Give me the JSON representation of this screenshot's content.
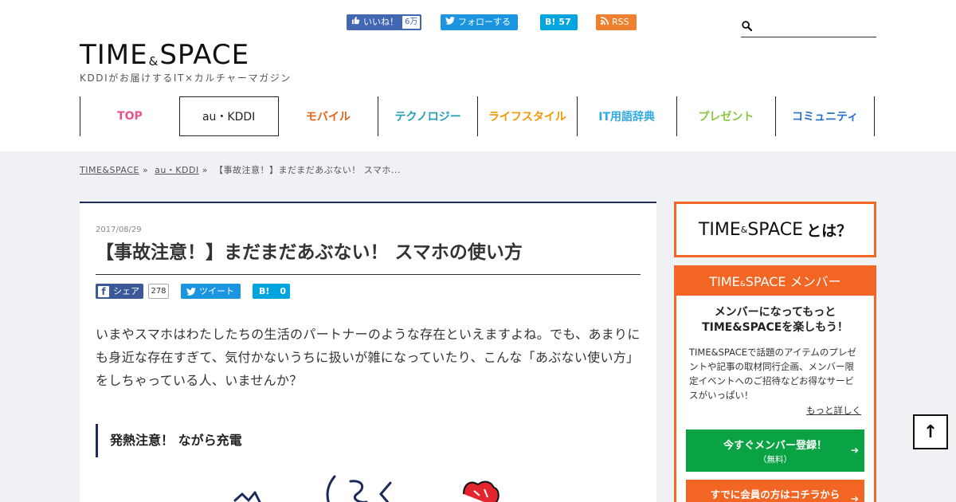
{
  "header": {
    "logo_left": "TIME",
    "logo_amp": "&",
    "logo_right": "SPACE",
    "tagline": "KDDIがお届けするIT×カルチャーマガジン",
    "social": {
      "facebook_label": "いいね！",
      "facebook_count": "6万",
      "twitter_label": "フォローする",
      "hatena_icon": "B!",
      "hatena_count": "57",
      "rss_label": "RSS"
    },
    "search": {
      "placeholder": "",
      "icon": "search-icon"
    }
  },
  "nav": {
    "items": [
      {
        "label": "TOP",
        "color": "#e8548a"
      },
      {
        "label": "au・KDDI",
        "color": "#222222"
      },
      {
        "label": "モバイル",
        "color": "#e8621a"
      },
      {
        "label": "テクノロジー",
        "color": "#1e9fb4"
      },
      {
        "label": "ライフスタイル",
        "color": "#f39800"
      },
      {
        "label": "IT用語辞典",
        "color": "#30a8e0"
      },
      {
        "label": "プレゼント",
        "color": "#8cc63f"
      },
      {
        "label": "コミュニティ",
        "color": "#2a6fc9"
      }
    ],
    "active_index": 1
  },
  "breadcrumb": {
    "items": [
      "TIME&SPACE",
      "au・KDDI"
    ],
    "sep": "»",
    "current": "【事故注意！】まだまだあぶない！ スマホ..."
  },
  "article": {
    "date": "2017/08/29",
    "title": "【事故注意！】まだまだあぶない！ スマホの使い方",
    "share": {
      "fb_icon": "f",
      "fb_label": "シェア",
      "fb_count": "278",
      "tw_label": "ツイート",
      "hb_icon": "B!",
      "hb_count": "0"
    },
    "lead": "いまやスマホはわたしたちの生活のパートナーのような存在といえますよね。でも、あまりにも身近な存在すぎて、気付かないうちに扱いが雑になっていたり、こんな「あぶない使い方」をしちゃっている人、いませんか？",
    "section_heading": "発熱注意！ ながら充電"
  },
  "sidebar": {
    "about": {
      "left": "TIME",
      "amp": "&",
      "right": "SPACE",
      "suffix": "とは？"
    },
    "member": {
      "head_left": "TIME",
      "head_amp": "&",
      "head_right": "SPACE",
      "head_suffix": "メンバー",
      "lead_line1": "メンバーになってもっと",
      "lead_line2": "TIME&SPACEを楽しもう！",
      "description": "TIME&SPACEで話題のアイテムのプレゼントや記事の取材同行企画、メンバー限定イベントへのご招待などお得なサービスがいっぱい！",
      "more_link": "もっと詳しく",
      "register_label": "今すぐメンバー登録！",
      "register_sub": "（無料）",
      "login_label": "すでに会員の方はコチラから",
      "arrow": "➔"
    }
  },
  "backtop": {
    "symbol": "↑"
  },
  "colors": {
    "accent_orange": "#f26522",
    "navy": "#1d2a5a",
    "green": "#0aa343"
  }
}
